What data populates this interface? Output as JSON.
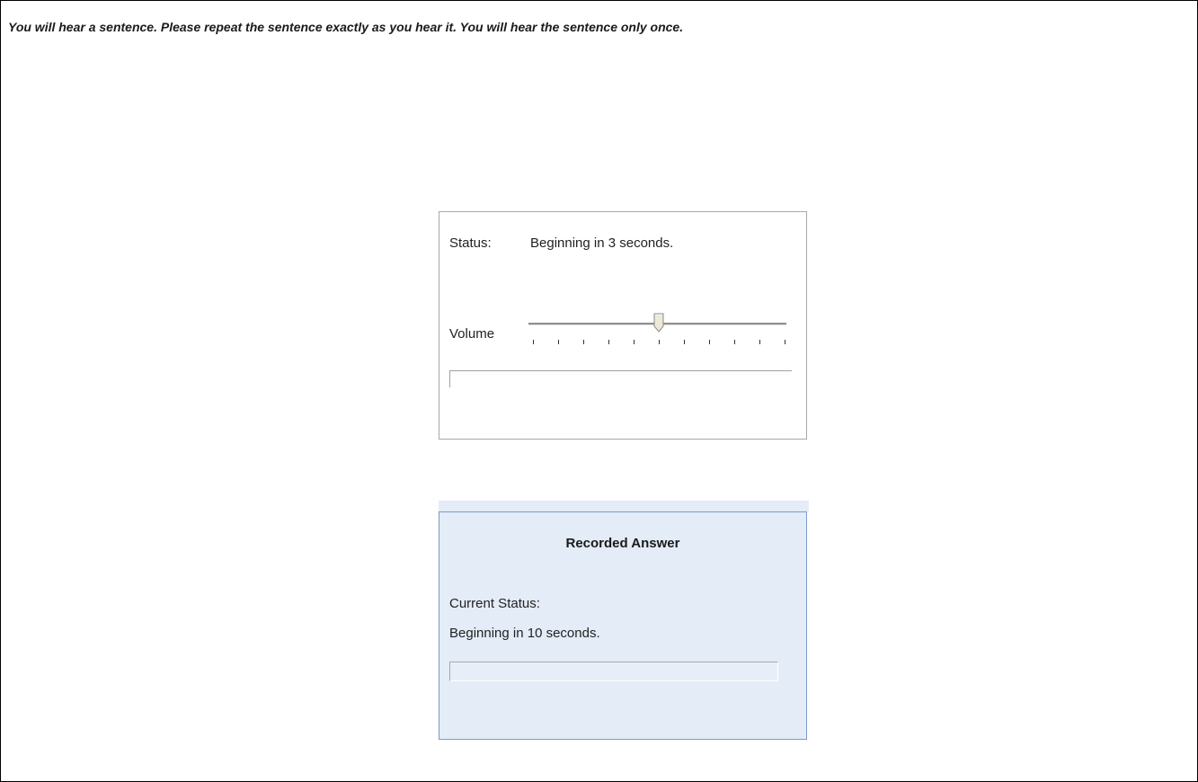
{
  "instruction": "You will hear a sentence. Please repeat the sentence exactly as you hear it.  You will hear the sentence only once.",
  "player": {
    "status_label": "Status:",
    "status_text": "Beginning in 3 seconds.",
    "volume_label": "Volume",
    "volume_level": 0.5,
    "volume_ticks": 11,
    "playback_progress": 0
  },
  "recorder": {
    "title": "Recorded Answer",
    "status_label": "Current Status:",
    "status_text": "Beginning in 10 seconds.",
    "recording_progress": 0
  },
  "colors": {
    "recorder_background": "#e3ecf7",
    "recorder_border": "#7a9cc8",
    "panel_border": "#a8a8a8"
  }
}
